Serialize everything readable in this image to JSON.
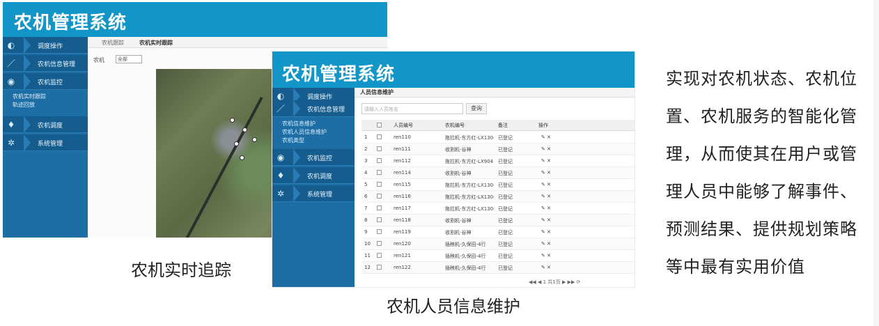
{
  "app_title": "农机管理系统",
  "tracking_screenshot": {
    "nav_items": [
      {
        "icon": "map-icon",
        "label": "调度操作"
      },
      {
        "icon": "pencil-icon",
        "label": "农机信息管理"
      },
      {
        "icon": "eye-icon",
        "label": "农机监控"
      },
      {
        "icon": "pin-icon",
        "label": "农机调度"
      },
      {
        "icon": "gear-icon",
        "label": "系统管理"
      }
    ],
    "sub_items": [
      "农机实时跟踪",
      "轨迹回放"
    ],
    "tabs": [
      "农机跟踪",
      "农机实时跟踪"
    ],
    "filter_label": "农机",
    "filter_value": "全部"
  },
  "personnel_screenshot": {
    "nav_items": [
      {
        "icon": "map-icon",
        "label": "调度操作"
      },
      {
        "icon": "pencil-icon",
        "label": "农机信息管理"
      },
      {
        "icon": "eye-icon",
        "label": "农机监控"
      },
      {
        "icon": "pin-icon",
        "label": "农机调度"
      },
      {
        "icon": "gear-icon",
        "label": "系统管理"
      }
    ],
    "sub_items": [
      "农机信息维护",
      "农机人员信息维护",
      "农机类型"
    ],
    "tab": "人员信息维护",
    "search_placeholder": "请输入人员姓名",
    "search_button": "查询",
    "columns": [
      "",
      "",
      "人员编号",
      "农机编号",
      "备注",
      "操作"
    ],
    "rows": [
      {
        "no": "1",
        "id": "ren110",
        "machine": "拖拉机-东方红-LX1304",
        "note": "已登记",
        "ops": "✎ ✕"
      },
      {
        "no": "2",
        "id": "ren111",
        "machine": "收割机-谷神",
        "note": "已登记",
        "ops": "✎ ✕"
      },
      {
        "no": "3",
        "id": "ren112",
        "machine": "拖拉机-东方红-LX904",
        "note": "已登记",
        "ops": "✎ ✕"
      },
      {
        "no": "4",
        "id": "ren114",
        "machine": "收割机-谷神",
        "note": "已登记",
        "ops": "✎ ✕"
      },
      {
        "no": "5",
        "id": "ren115",
        "machine": "拖拉机-东方红-LX1304",
        "note": "已登记",
        "ops": "✎ ✕"
      },
      {
        "no": "6",
        "id": "ren116",
        "machine": "拖拉机-东方红-LX1304",
        "note": "已登记",
        "ops": "✎ ✕"
      },
      {
        "no": "7",
        "id": "ren117",
        "machine": "拖拉机-东方红-LX1304",
        "note": "已登记",
        "ops": "✎ ✕"
      },
      {
        "no": "8",
        "id": "ren118",
        "machine": "收割机-谷神",
        "note": "已登记",
        "ops": "✎ ✕"
      },
      {
        "no": "9",
        "id": "ren119",
        "machine": "收割机-谷神",
        "note": "已登记",
        "ops": "✎ ✕"
      },
      {
        "no": "10",
        "id": "ren120",
        "machine": "插秧机-久保田-4行",
        "note": "已登记",
        "ops": "✎ ✕"
      },
      {
        "no": "11",
        "id": "ren121",
        "machine": "插秧机-久保田-4行",
        "note": "已登记",
        "ops": "✎ ✕"
      },
      {
        "no": "12",
        "id": "ren122",
        "machine": "插秧机-久保田-4行",
        "note": "已登记",
        "ops": "✎ ✕"
      }
    ],
    "pager": "◀◀ ◀ 1 共1页 ▶ ▶▶ ⟳"
  },
  "captions": {
    "tracking": "农机实时追踪",
    "personnel": "农机人员信息维护"
  },
  "description": "实现对农机状态、农机位置、农机服务的智能化管理，从而使其在用户或管理人员中能够了解事件、预测结果、提供规划策略等中最有实用价值"
}
